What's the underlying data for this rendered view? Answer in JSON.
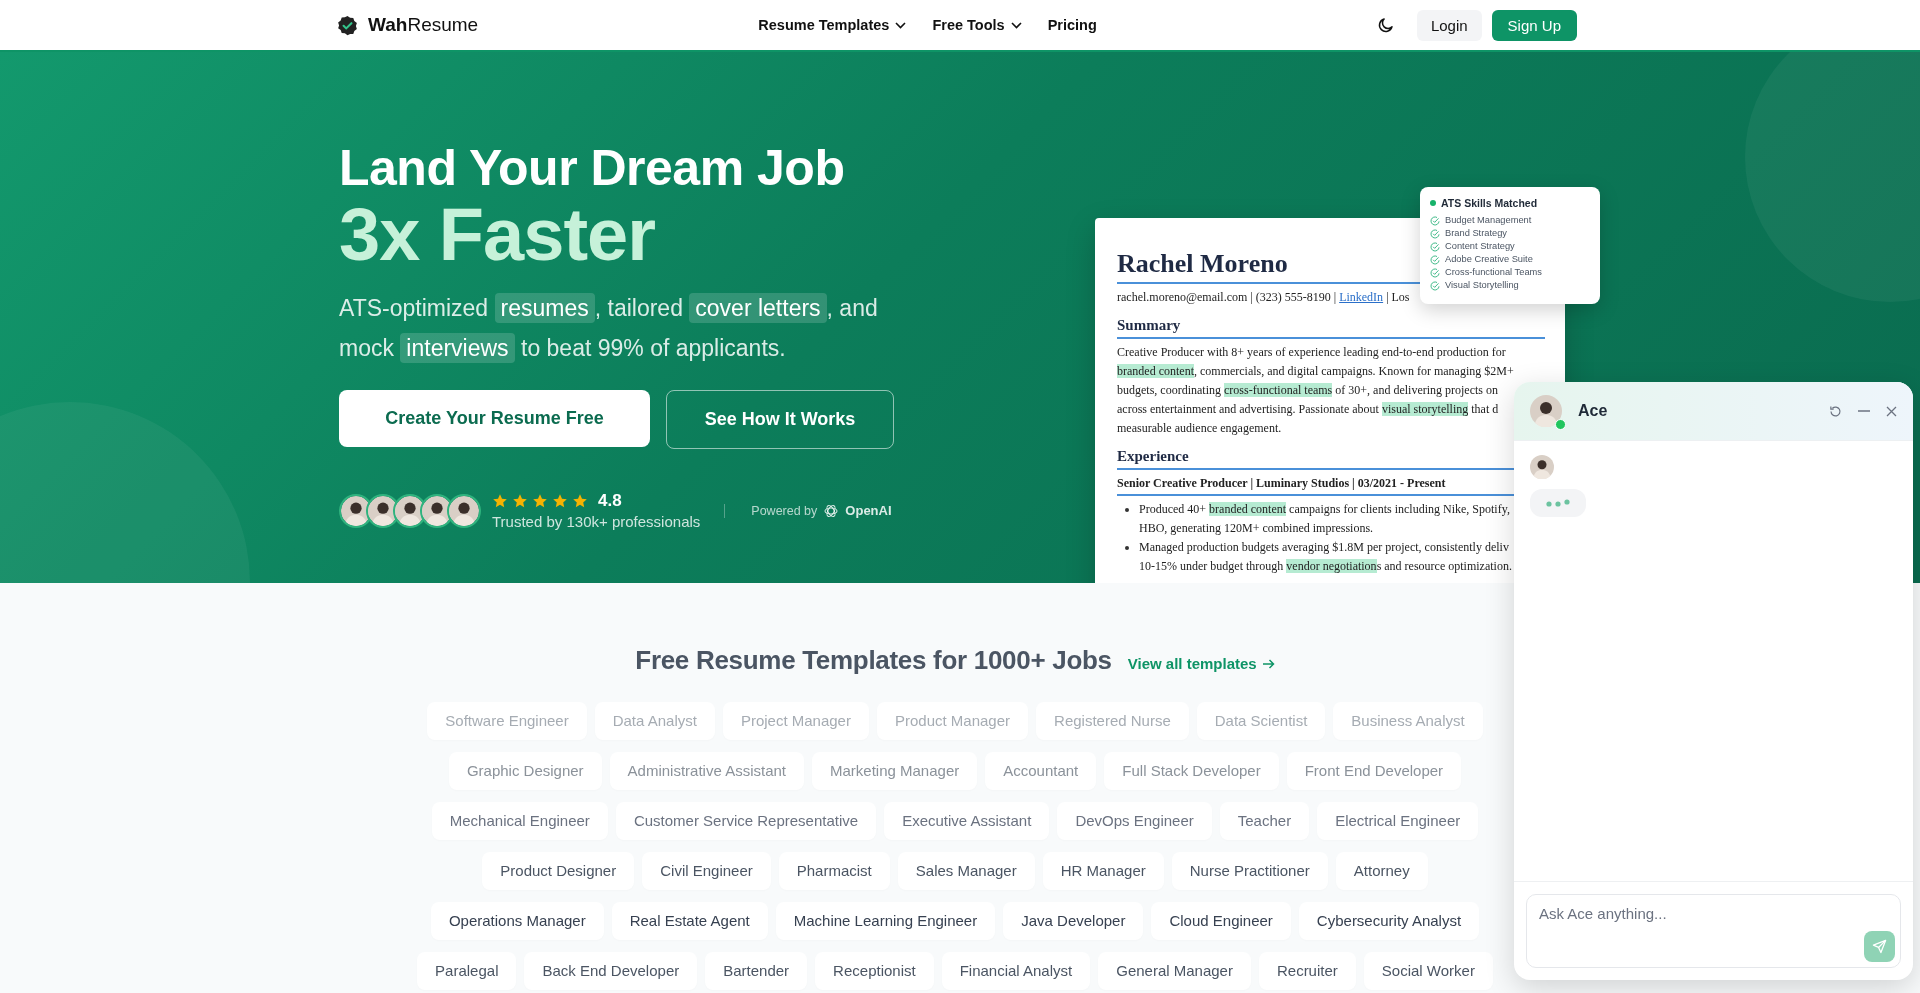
{
  "header": {
    "logo": "**Wah**Resume",
    "nav": [
      {
        "label": "Resume Templates",
        "dropdown": true
      },
      {
        "label": "Free Tools",
        "dropdown": true
      },
      {
        "label": "Pricing",
        "dropdown": false
      }
    ],
    "login": "Login",
    "signup": "Sign Up"
  },
  "hero": {
    "title": "Land Your Dream Job",
    "title_accent": "3x Faster",
    "subtitle": [
      {
        "text": "ATS-optimized ",
        "highlight": false
      },
      {
        "text": "resumes",
        "highlight": true
      },
      {
        "text": ", tailored ",
        "highlight": false
      },
      {
        "text": "cover letters",
        "highlight": true
      },
      {
        "text": ", and mock ",
        "highlight": false
      },
      {
        "text": "interviews",
        "highlight": true
      },
      {
        "text": " to beat 99% of applicants.",
        "highlight": false
      }
    ],
    "buttons": [
      {
        "label": "Create Your Resume Free",
        "kind": "primary"
      },
      {
        "label": "See How It Works",
        "kind": "outline"
      }
    ],
    "rating": {
      "stars": 5,
      "score": "4.8",
      "caption": "Trusted by 130k+ professionals"
    },
    "powered_by": {
      "label": "Powered by",
      "brand": "OpenAI"
    }
  },
  "resume": {
    "name": "Rachel Moreno",
    "contact": [
      {
        "text": "rachel.moreno@email.com | (323) 555-8190 | ",
        "link": false
      },
      {
        "text": "LinkedIn",
        "link": true
      },
      {
        "text": " | Los",
        "link": false
      }
    ],
    "summary": {
      "heading": "Summary",
      "lines": [
        [
          {
            "text": "Creative Producer with 8+ years of experience leading end-to-end production for",
            "highlight": false
          }
        ],
        [
          {
            "text": "branded content",
            "highlight": true
          },
          {
            "text": ", commercials, and digital campaigns. Known for managing $2M+",
            "highlight": false
          }
        ],
        [
          {
            "text": "budgets, coordinating ",
            "highlight": false
          },
          {
            "text": "cross-functional teams",
            "highlight": true
          },
          {
            "text": " of 30+, and delivering projects on",
            "highlight": false
          }
        ],
        [
          {
            "text": "across entertainment and advertising. Passionate about ",
            "highlight": false
          },
          {
            "text": "visual storytelling",
            "highlight": true
          },
          {
            "text": " that d",
            "highlight": false
          }
        ],
        [
          {
            "text": "measurable audience engagement.",
            "highlight": false
          }
        ]
      ]
    },
    "experience": {
      "heading": "Experience",
      "role": "Senior Creative Producer | Luminary Studios | 03/2021 - Present",
      "bullets": [
        [
          [
            {
              "text": "Produced 40+ ",
              "highlight": false
            },
            {
              "text": "branded content",
              "highlight": true
            },
            {
              "text": " campaigns for clients including Nike, Spotify,",
              "highlight": false
            }
          ],
          [
            {
              "text": "HBO, generating 120M+ combined impressions.",
              "highlight": false
            }
          ]
        ],
        [
          [
            {
              "text": "Managed production budgets averaging $1.8M per project, consistently deliv",
              "highlight": false
            }
          ],
          [
            {
              "text": "10-15% under budget through ",
              "highlight": false
            },
            {
              "text": "vendor negotiation",
              "highlight": true
            },
            {
              "text": "s and resource optimization.",
              "highlight": false
            }
          ]
        ]
      ]
    }
  },
  "ats": {
    "title": "ATS Skills Matched",
    "skills": [
      "Budget Management",
      "Brand Strategy",
      "Content Strategy",
      "Adobe Creative Suite",
      "Cross-functional Teams",
      "Visual Storytelling"
    ]
  },
  "chat": {
    "name": "Ace",
    "online": true,
    "typing": true,
    "placeholder": "Ask Ace anything...",
    "send_disabled": true
  },
  "templates": {
    "title": "Free Resume Templates for 1000+ Jobs",
    "link": "View all templates",
    "rows": [
      [
        "Software Engineer",
        "Data Analyst",
        "Project Manager",
        "Product Manager",
        "Registered Nurse",
        "Data Scientist",
        "Business Analyst"
      ],
      [
        "Graphic Designer",
        "Administrative Assistant",
        "Marketing Manager",
        "Accountant",
        "Full Stack Developer",
        "Front End Developer"
      ],
      [
        "Mechanical Engineer",
        "Customer Service Representative",
        "Executive Assistant",
        "DevOps Engineer",
        "Teacher",
        "Electrical Engineer"
      ],
      [
        "Product Designer",
        "Civil Engineer",
        "Pharmacist",
        "Sales Manager",
        "HR Manager",
        "Nurse Practitioner",
        "Attorney"
      ],
      [
        "Operations Manager",
        "Real Estate Agent",
        "Machine Learning Engineer",
        "Java Developer",
        "Cloud Engineer",
        "Cybersecurity Analyst"
      ],
      [
        "Paralegal",
        "Back End Developer",
        "Bartender",
        "Receptionist",
        "Financial Analyst",
        "General Manager",
        "Recruiter",
        "Social Worker"
      ]
    ]
  }
}
